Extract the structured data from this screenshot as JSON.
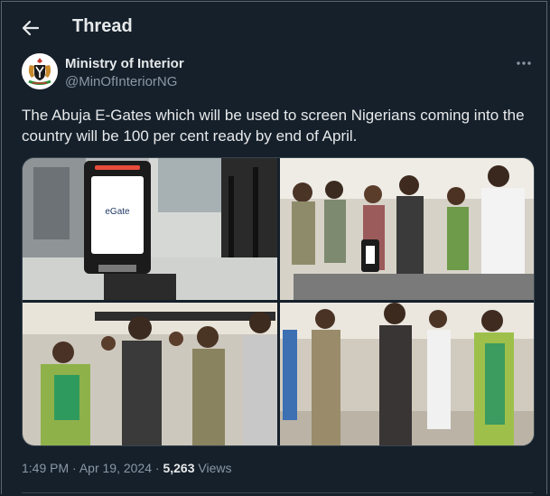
{
  "header": {
    "title": "Thread",
    "back_icon": "arrow-left-icon"
  },
  "tweet": {
    "author": {
      "name": "Ministry of Interior",
      "handle": "@MinOfInteriorNG",
      "avatar": "nigeria-coat-of-arms"
    },
    "text": "The Abuja E-Gates which will be used to screen Nigerians coming into the country will be 100 per cent ready by end of April.",
    "media": {
      "count": 4,
      "photos": [
        {
          "alt": "eGate kiosk at airport",
          "screen_label": "eGate"
        },
        {
          "alt": "Officials inspecting the e-gate"
        },
        {
          "alt": "Officials at e-gate launch"
        },
        {
          "alt": "Officials walking through the airport"
        }
      ]
    },
    "time": "1:49 PM",
    "date": "Apr 19, 2024",
    "separator": "·",
    "views_count": "5,263",
    "views_label": "Views"
  },
  "colors": {
    "background": "#15202b",
    "text": "#e7e9ea",
    "secondary": "#8b98a5",
    "border": "#38444d"
  }
}
